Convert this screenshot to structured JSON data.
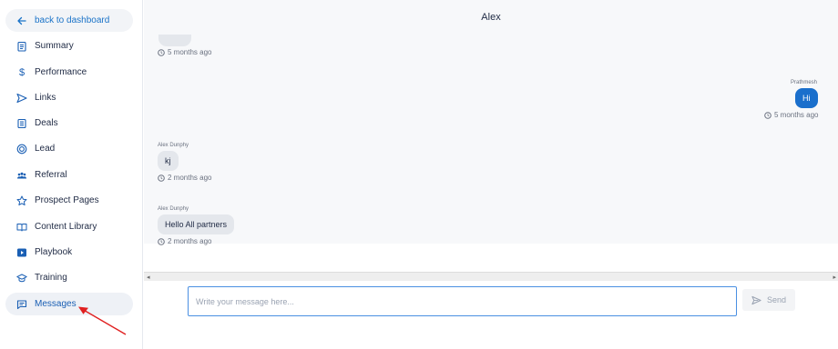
{
  "sidebar": {
    "back_label": "back to dashboard",
    "items": [
      {
        "label": "Summary",
        "icon": "clipboard-icon"
      },
      {
        "label": "Performance",
        "icon": "dollar-icon"
      },
      {
        "label": "Links",
        "icon": "send-icon"
      },
      {
        "label": "Deals",
        "icon": "document-icon"
      },
      {
        "label": "Lead",
        "icon": "target-icon"
      },
      {
        "label": "Referral",
        "icon": "users-icon"
      },
      {
        "label": "Prospect Pages",
        "icon": "star-icon"
      },
      {
        "label": "Content Library",
        "icon": "book-icon"
      },
      {
        "label": "Playbook",
        "icon": "play-icon"
      },
      {
        "label": "Training",
        "icon": "graduation-cap-icon"
      },
      {
        "label": "Messages",
        "icon": "chat-icon",
        "active": true
      }
    ]
  },
  "chat": {
    "title": "Alex",
    "messages": [
      {
        "sender": "",
        "text": "",
        "time": "5 months ago",
        "direction": "incoming"
      },
      {
        "sender": "Prathmesh",
        "text": "Hi",
        "time": "5 months ago",
        "direction": "outgoing"
      },
      {
        "sender": "Alex Dunphy",
        "text": "kj",
        "time": "2 months ago",
        "direction": "incoming"
      },
      {
        "sender": "Alex Dunphy",
        "text": "Hello All partners",
        "time": "2 months ago",
        "direction": "incoming"
      }
    ]
  },
  "composer": {
    "placeholder": "Write your message here...",
    "value": "",
    "send_label": "Send"
  },
  "colors": {
    "accent": "#1a6fcc",
    "chat_bg": "#f7f8fa",
    "bubble_in": "#e4e7ec",
    "annotation_arrow": "#e02020"
  }
}
